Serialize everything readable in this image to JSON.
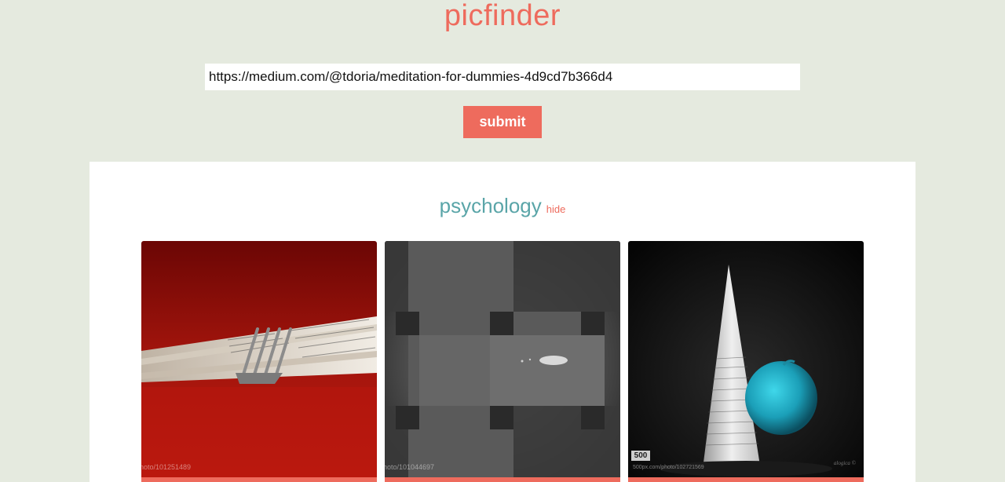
{
  "app": {
    "title": "picfinder"
  },
  "form": {
    "url_value": "https://medium.com/@tdoria/meditation-for-dummies-4d9cd7b366d4",
    "submit_label": "submit"
  },
  "results": {
    "section_title": "psychology",
    "hide_label": "hide",
    "photos": [
      {
        "credit": "hoto/101251489",
        "subject": "fork on book pages"
      },
      {
        "credit": "hoto/101044697",
        "subject": "woven grey pattern"
      },
      {
        "credit": "500px.com/photo/102721569",
        "badge": "500",
        "signature": "alogica ©",
        "subject": "paper cone and blue apple"
      }
    ]
  },
  "colors": {
    "accent": "#ee6b5d",
    "teal": "#5aa5a8",
    "background": "#e5eadf"
  }
}
